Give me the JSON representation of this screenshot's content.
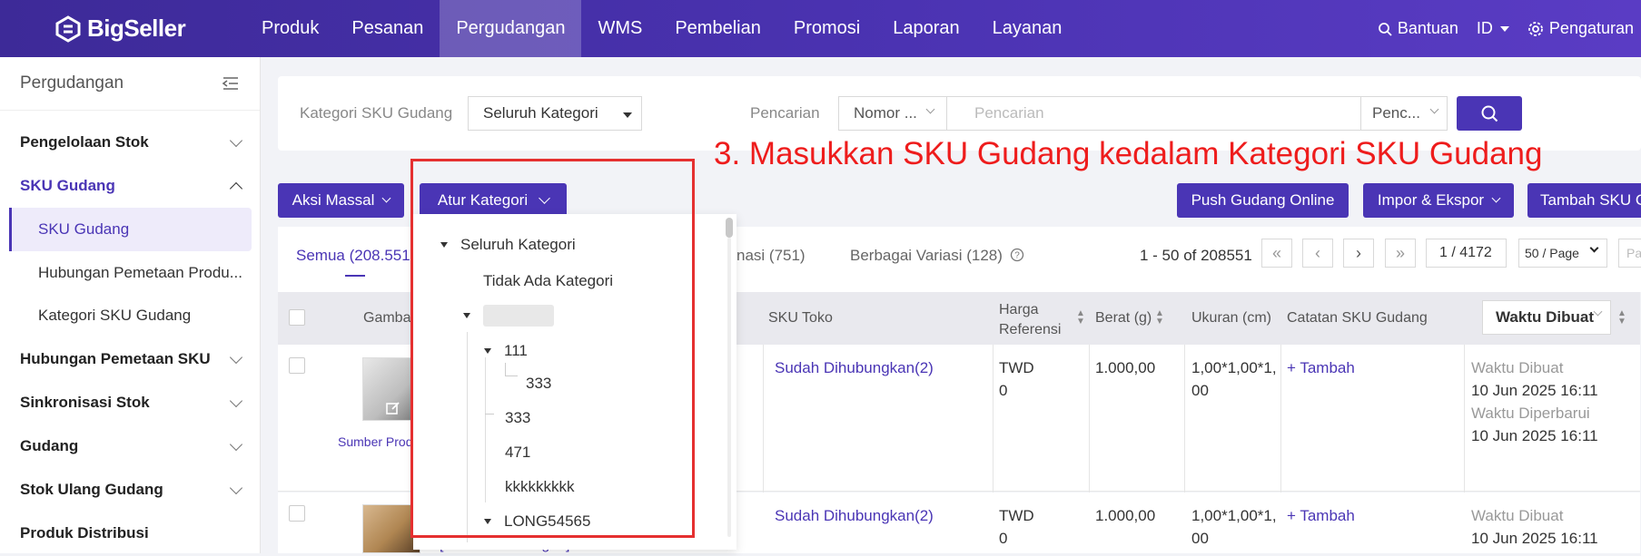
{
  "brand": {
    "name": "BigSeller"
  },
  "nav": {
    "items": [
      "Produk",
      "Pesanan",
      "Pergudangan",
      "WMS",
      "Pembelian",
      "Promosi",
      "Laporan",
      "Layanan"
    ],
    "active": "Pergudangan"
  },
  "topright": {
    "help": "Bantuan",
    "lang": "ID",
    "settings": "Pengaturan"
  },
  "sidebar": {
    "title": "Pergudangan",
    "items": [
      {
        "label": "Pengelolaan Stok"
      },
      {
        "label": "SKU Gudang"
      },
      {
        "label": "Hubungan Pemetaan SKU"
      },
      {
        "label": "Sinkronisasi Stok"
      },
      {
        "label": "Gudang"
      },
      {
        "label": "Stok Ulang Gudang"
      },
      {
        "label": "Produk Distribusi"
      }
    ],
    "subitems": [
      "SKU Gudang",
      "Hubungan Pemetaan Produ...",
      "Kategori SKU Gudang"
    ]
  },
  "filter": {
    "category_label": "Kategori SKU Gudang",
    "category_value": "Seluruh Kategori",
    "search_label": "Pencarian",
    "search_type": "Nomor ...",
    "search_placeholder": "Pencarian",
    "search_mode": "Penc..."
  },
  "annotation": "3. Masukkan SKU Gudang kedalam Kategori SKU Gudang",
  "toolbar": {
    "bulk": "Aksi Massal",
    "set_category": "Atur Kategori",
    "push": "Push Gudang Online",
    "import_export": "Impor & Ekspor",
    "add": "Tambah SKU G"
  },
  "tree": {
    "root": "Seluruh Kategori",
    "none": "Tidak Ada Kategori",
    "n111": "111",
    "n333a": "333",
    "n333b": "333",
    "n471": "471",
    "nk": "kkkkkkkkk",
    "nlong": "LONG54565"
  },
  "tabs": {
    "all": "Semua (208.551)",
    "single": "nasi (751)",
    "multi": "Berbagai Variasi (128)"
  },
  "pagination": {
    "range": "1 - 50 of 208551",
    "page": "1 / 4172",
    "per_page": "50 / Page",
    "goto": "Pa"
  },
  "table": {
    "headers": {
      "image": "Gambar",
      "shop_sku": "SKU Toko",
      "price": "Harga Referensi",
      "weight": "Berat (g)",
      "size": "Ukuran (cm)",
      "note": "Catatan SKU Gudang",
      "time": "Waktu Dibuat"
    },
    "rows": [
      {
        "source": "Sumber Produ",
        "shop_sku": "Sudah Dihubungkan(2)",
        "currency": "TWD",
        "price": "0",
        "weight": "1.000,00",
        "size1": "1,00*1,00*1,",
        "size2": "00",
        "note": "+ Tambah",
        "created_label": "Waktu Dibuat",
        "created": "10 Jun 2025 16:11",
        "updated_label": "Waktu Diperbarui",
        "updated": "10 Jun 2025 16:11"
      },
      {
        "source": "[Tidak Ada Kategori]",
        "shop_sku": "Sudah Dihubungkan(2)",
        "currency": "TWD",
        "price": "0",
        "weight": "1.000,00",
        "size1": "1,00*1,00*1,",
        "size2": "00",
        "note": "+ Tambah",
        "created_label": "Waktu Dibuat",
        "created": "10 Jun 2025 16:11"
      }
    ]
  },
  "colors": {
    "brand": "#4a35b5",
    "annotation": "#ee1c1c"
  }
}
